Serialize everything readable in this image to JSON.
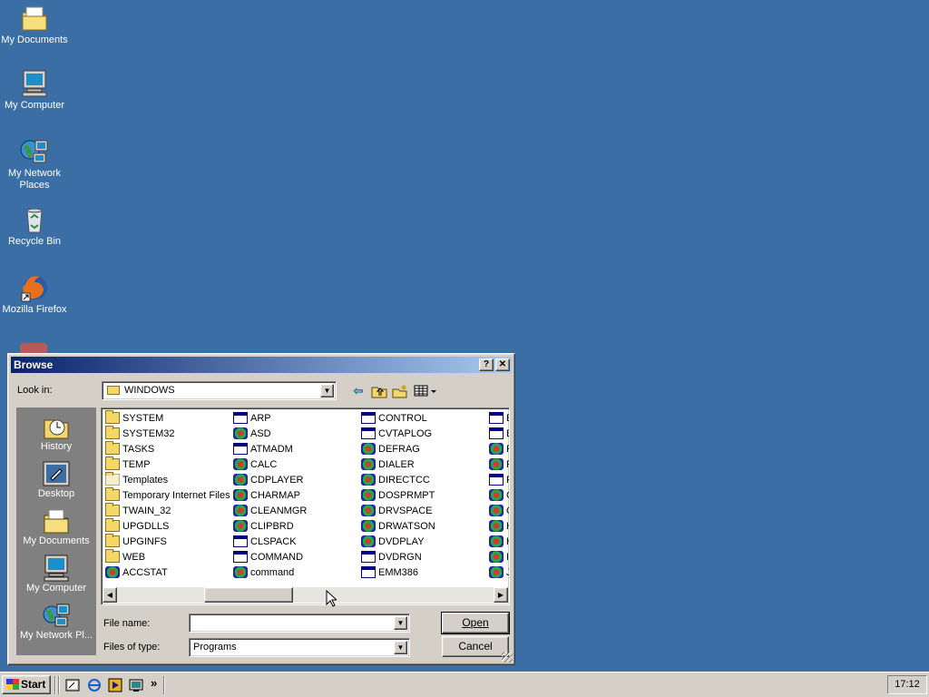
{
  "desktop": {
    "icons": [
      {
        "label": "My Documents",
        "icon": "folder-documents-icon"
      },
      {
        "label": "My Computer",
        "icon": "computer-icon"
      },
      {
        "label": "My Network Places",
        "icon": "network-icon"
      },
      {
        "label": "Recycle Bin",
        "icon": "recycle-bin-icon"
      },
      {
        "label": "Mozilla Firefox",
        "icon": "firefox-icon"
      }
    ]
  },
  "dialog": {
    "title": "Browse",
    "help_button": "?",
    "close_button": "✕",
    "look_in_label": "Look in:",
    "look_in_value": "WINDOWS",
    "places": [
      {
        "label": "History",
        "icon": "history-icon"
      },
      {
        "label": "Desktop",
        "icon": "desktop-icon"
      },
      {
        "label": "My Documents",
        "icon": "folder-documents-icon"
      },
      {
        "label": "My Computer",
        "icon": "computer-icon"
      },
      {
        "label": "My Network Pl...",
        "icon": "network-icon"
      }
    ],
    "files": {
      "col1": [
        {
          "name": "SYSTEM",
          "type": "folder"
        },
        {
          "name": "SYSTEM32",
          "type": "folder"
        },
        {
          "name": "TASKS",
          "type": "folder"
        },
        {
          "name": "TEMP",
          "type": "folder"
        },
        {
          "name": "Templates",
          "type": "folder-light"
        },
        {
          "name": "Temporary Internet Files",
          "type": "folder"
        },
        {
          "name": "TWAIN_32",
          "type": "folder"
        },
        {
          "name": "UPGDLLS",
          "type": "folder"
        },
        {
          "name": "UPGINFS",
          "type": "folder"
        },
        {
          "name": "WEB",
          "type": "folder"
        },
        {
          "name": "ACCSTAT",
          "type": "app"
        }
      ],
      "col2": [
        {
          "name": "ARP",
          "type": "exe"
        },
        {
          "name": "ASD",
          "type": "app"
        },
        {
          "name": "ATMADM",
          "type": "exe"
        },
        {
          "name": "CALC",
          "type": "app"
        },
        {
          "name": "CDPLAYER",
          "type": "app"
        },
        {
          "name": "CHARMAP",
          "type": "app"
        },
        {
          "name": "CLEANMGR",
          "type": "app"
        },
        {
          "name": "CLIPBRD",
          "type": "app"
        },
        {
          "name": "CLSPACK",
          "type": "exe"
        },
        {
          "name": "COMMAND",
          "type": "exe"
        },
        {
          "name": "command",
          "type": "app"
        }
      ],
      "col3": [
        {
          "name": "CONTROL",
          "type": "exe"
        },
        {
          "name": "CVTAPLOG",
          "type": "exe"
        },
        {
          "name": "DEFRAG",
          "type": "app"
        },
        {
          "name": "DIALER",
          "type": "app"
        },
        {
          "name": "DIRECTCC",
          "type": "app"
        },
        {
          "name": "DOSPRMPT",
          "type": "app"
        },
        {
          "name": "DRVSPACE",
          "type": "app"
        },
        {
          "name": "DRWATSON",
          "type": "app"
        },
        {
          "name": "DVDPLAY",
          "type": "app"
        },
        {
          "name": "DVDRGN",
          "type": "exe"
        },
        {
          "name": "EMM386",
          "type": "exe"
        }
      ],
      "col4": [
        {
          "name": "E",
          "type": "exe"
        },
        {
          "name": "E",
          "type": "exe"
        },
        {
          "name": "F",
          "type": "app"
        },
        {
          "name": "F",
          "type": "app"
        },
        {
          "name": "F",
          "type": "exe"
        },
        {
          "name": "G",
          "type": "app"
        },
        {
          "name": "G",
          "type": "app"
        },
        {
          "name": "H",
          "type": "app"
        },
        {
          "name": "H",
          "type": "app"
        },
        {
          "name": "II",
          "type": "app"
        },
        {
          "name": "J",
          "type": "app"
        }
      ]
    },
    "file_name_label": "File name:",
    "file_name_value": "",
    "files_of_type_label": "Files of type:",
    "files_of_type_value": "Programs",
    "open_button": "Open",
    "cancel_button": "Cancel"
  },
  "taskbar": {
    "start_label": "Start",
    "quick_launch": [
      "show-desktop-icon",
      "internet-explorer-icon",
      "media-player-icon",
      "desktop-icon"
    ],
    "overflow": "»",
    "clock": "17:12"
  },
  "colors": {
    "desktop": "#3a6ea5",
    "titlebar_start": "#0a246a",
    "titlebar_end": "#a6caf0",
    "face": "#d4d0c8"
  }
}
